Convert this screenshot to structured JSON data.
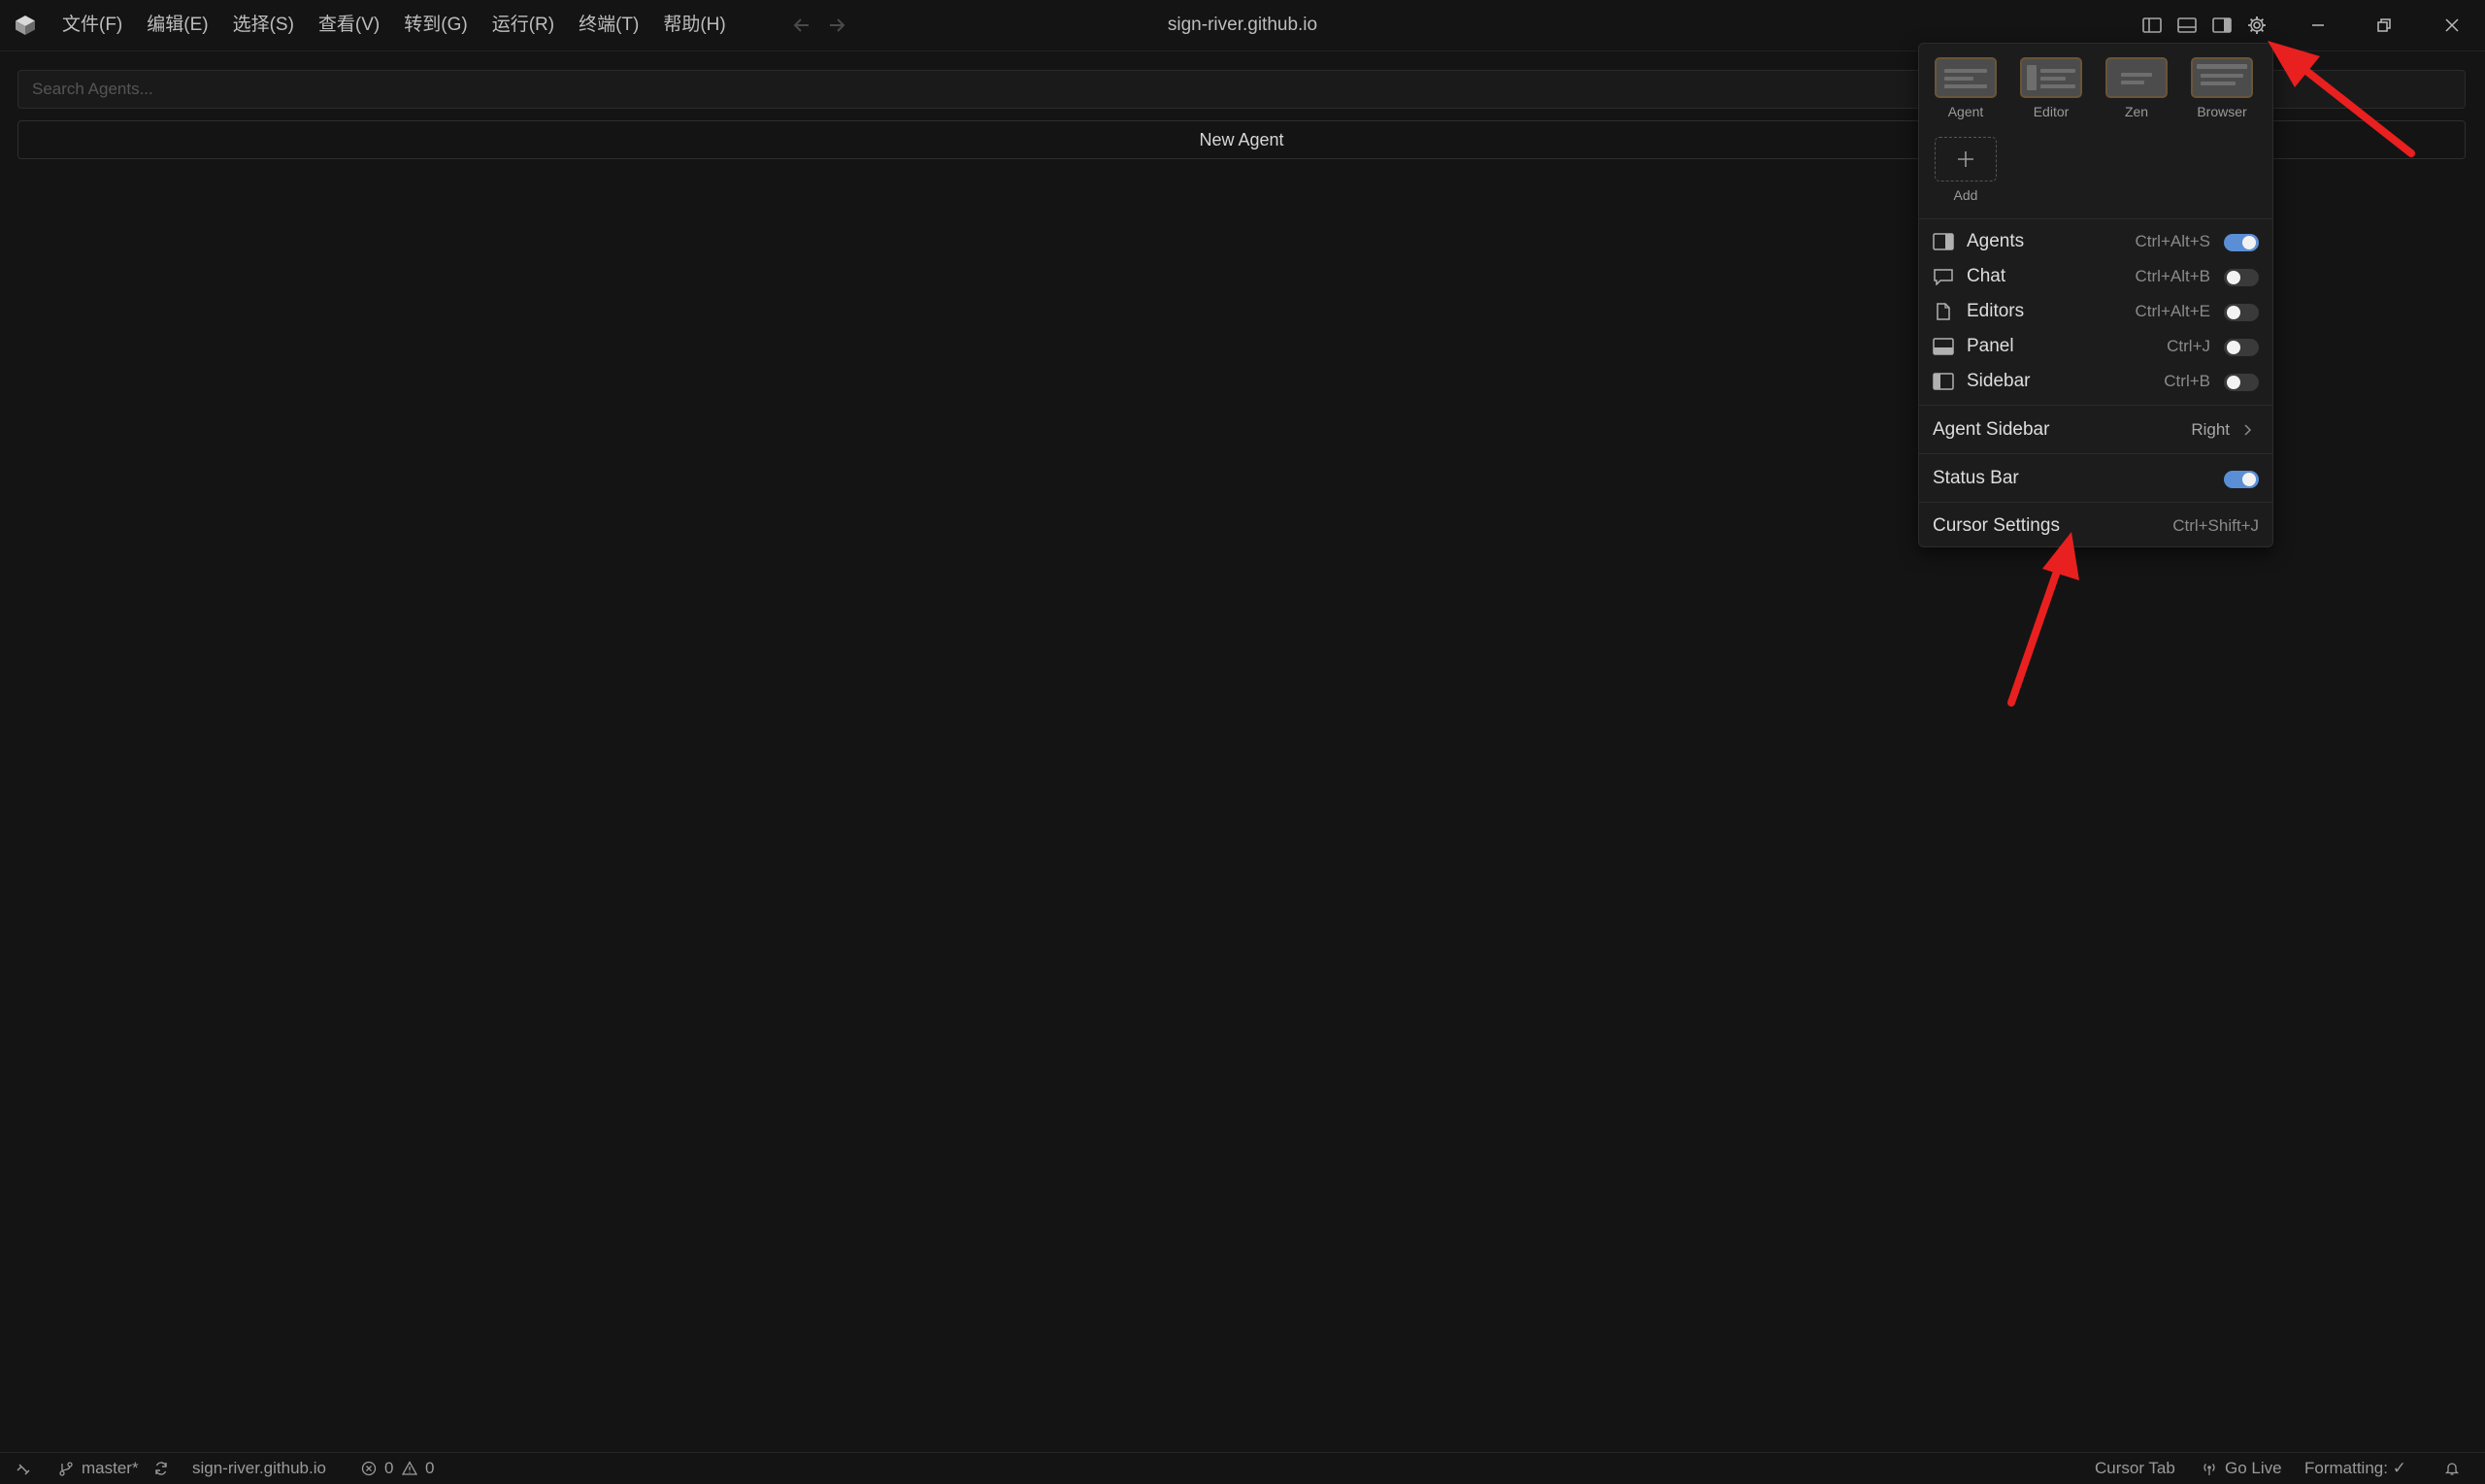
{
  "titlebar": {
    "menu": [
      "文件(F)",
      "编辑(E)",
      "选择(S)",
      "查看(V)",
      "转到(G)",
      "运行(R)",
      "终端(T)",
      "帮助(H)"
    ],
    "title": "sign-river.github.io"
  },
  "main": {
    "search_placeholder": "Search Agents...",
    "new_agent_label": "New Agent"
  },
  "popup": {
    "layouts": [
      {
        "label": "Agent",
        "icon": "agent-layout-thumbnail"
      },
      {
        "label": "Editor",
        "icon": "editor-layout-thumbnail"
      },
      {
        "label": "Zen",
        "icon": "zen-layout-thumbnail"
      },
      {
        "label": "Browser",
        "icon": "browser-layout-thumbnail"
      }
    ],
    "add_label": "Add",
    "toggles": [
      {
        "label": "Agents",
        "shortcut": "Ctrl+Alt+S",
        "on": true,
        "icon": "right-panel-icon"
      },
      {
        "label": "Chat",
        "shortcut": "Ctrl+Alt+B",
        "on": false,
        "icon": "chat-bubble-icon"
      },
      {
        "label": "Editors",
        "shortcut": "Ctrl+Alt+E",
        "on": false,
        "icon": "file-icon"
      },
      {
        "label": "Panel",
        "shortcut": "Ctrl+J",
        "on": false,
        "icon": "bottom-panel-icon"
      },
      {
        "label": "Sidebar",
        "shortcut": "Ctrl+B",
        "on": false,
        "icon": "left-panel-icon"
      }
    ],
    "agent_sidebar": {
      "label": "Agent Sidebar",
      "value": "Right"
    },
    "status_bar": {
      "label": "Status Bar",
      "on": true
    },
    "cursor_settings": {
      "label": "Cursor Settings",
      "shortcut": "Ctrl+Shift+J"
    }
  },
  "statusbar": {
    "branch": "master*",
    "repo": "sign-river.github.io",
    "errors": "0",
    "warnings": "0",
    "cursor_tab": "Cursor Tab",
    "go_live": "Go Live",
    "formatting": "Formatting: ✓"
  },
  "colors": {
    "background": "#141414",
    "toggle_on": "#5a8fd6",
    "annotation_arrow": "#e8201f"
  }
}
